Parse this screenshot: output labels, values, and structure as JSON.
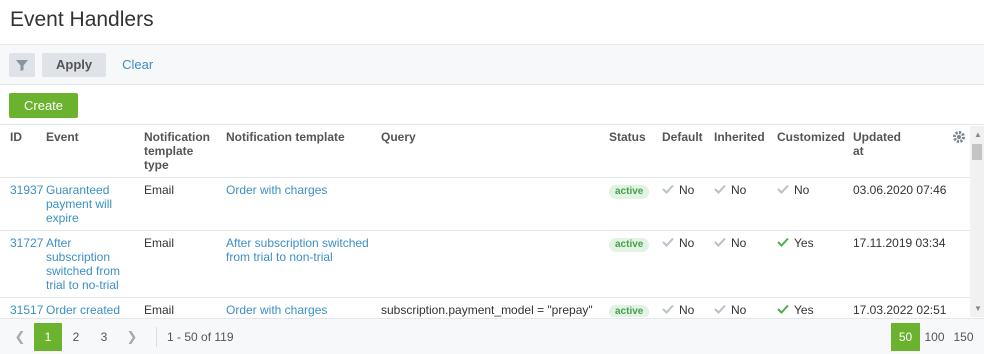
{
  "page": {
    "title": "Event Handlers"
  },
  "filterbar": {
    "apply_label": "Apply",
    "clear_label": "Clear"
  },
  "actions": {
    "create_label": "Create"
  },
  "table": {
    "columns": [
      "ID",
      "Event",
      "Notification template type",
      "Notification template",
      "Query",
      "Status",
      "Default",
      "Inherited",
      "Customized",
      "Updated at"
    ],
    "rows": [
      {
        "id": "31937",
        "event": "Guaranteed payment will expire",
        "type": "Email",
        "template": "Order with charges",
        "query": "",
        "status": "active",
        "default": "No",
        "inherited": "No",
        "customized": "No",
        "customized_yes": false,
        "updated": "03.06.2020 07:46"
      },
      {
        "id": "31727",
        "event": "After subscription switched from trial to no-trial",
        "type": "Email",
        "template": "After subscription switched from trial to non-trial",
        "query": "",
        "status": "active",
        "default": "No",
        "inherited": "No",
        "customized": "Yes",
        "customized_yes": true,
        "updated": "17.11.2019 03:34"
      },
      {
        "id": "31517",
        "event": "Order created",
        "type": "Email",
        "template": "Order with charges",
        "query": "subscription.payment_model = \"prepay\"",
        "status": "active",
        "default": "No",
        "inherited": "No",
        "customized": "Yes",
        "customized_yes": true,
        "updated": "17.03.2022 02:51"
      }
    ]
  },
  "pager": {
    "pages": [
      "1",
      "2",
      "3"
    ],
    "current": "1",
    "range": "1 - 50 of 119",
    "sizes": [
      "50",
      "100",
      "150"
    ],
    "current_size": "50"
  },
  "colors": {
    "accent": "#6bb32e",
    "link": "#3b8fc4",
    "badge_bg": "#e1f3e2",
    "badge_text": "#4a9e4c",
    "check_gray": "#b8c0c8",
    "check_green": "#4caf50"
  }
}
